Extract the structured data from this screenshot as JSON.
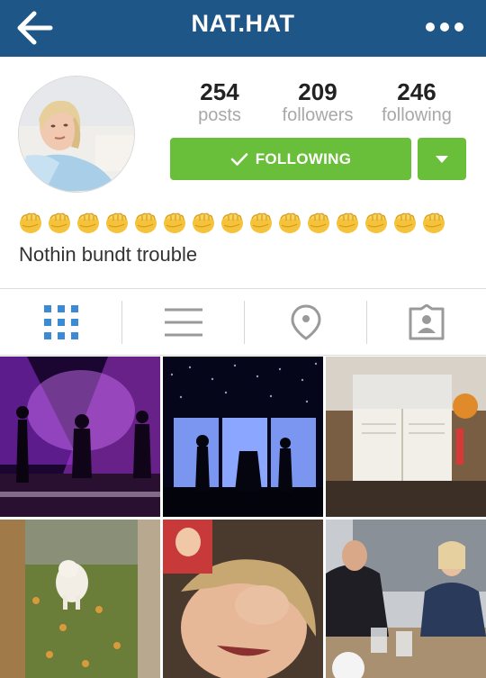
{
  "header": {
    "title": "NAT.HAT",
    "back_icon": "arrow-left-icon",
    "more_icon": "more-dots-icon",
    "bg_color": "#1f5688"
  },
  "profile": {
    "stats": [
      {
        "value": "254",
        "label": "posts"
      },
      {
        "value": "209",
        "label": "followers"
      },
      {
        "value": "246",
        "label": "following"
      }
    ],
    "follow_button": {
      "label": "FOLLOWING",
      "color": "#6abf3a"
    },
    "bio_emoji": "👊👊👊👊👊👊👊👊👊👊👊👊👊👊👊",
    "bio_text": "Nothin bundt trouble"
  },
  "tabs": [
    {
      "icon": "grid-icon",
      "active": true
    },
    {
      "icon": "list-icon",
      "active": false
    },
    {
      "icon": "location-pin-icon",
      "active": false
    },
    {
      "icon": "tagged-photos-icon",
      "active": false
    }
  ],
  "accent_color": "#3a8ad6"
}
